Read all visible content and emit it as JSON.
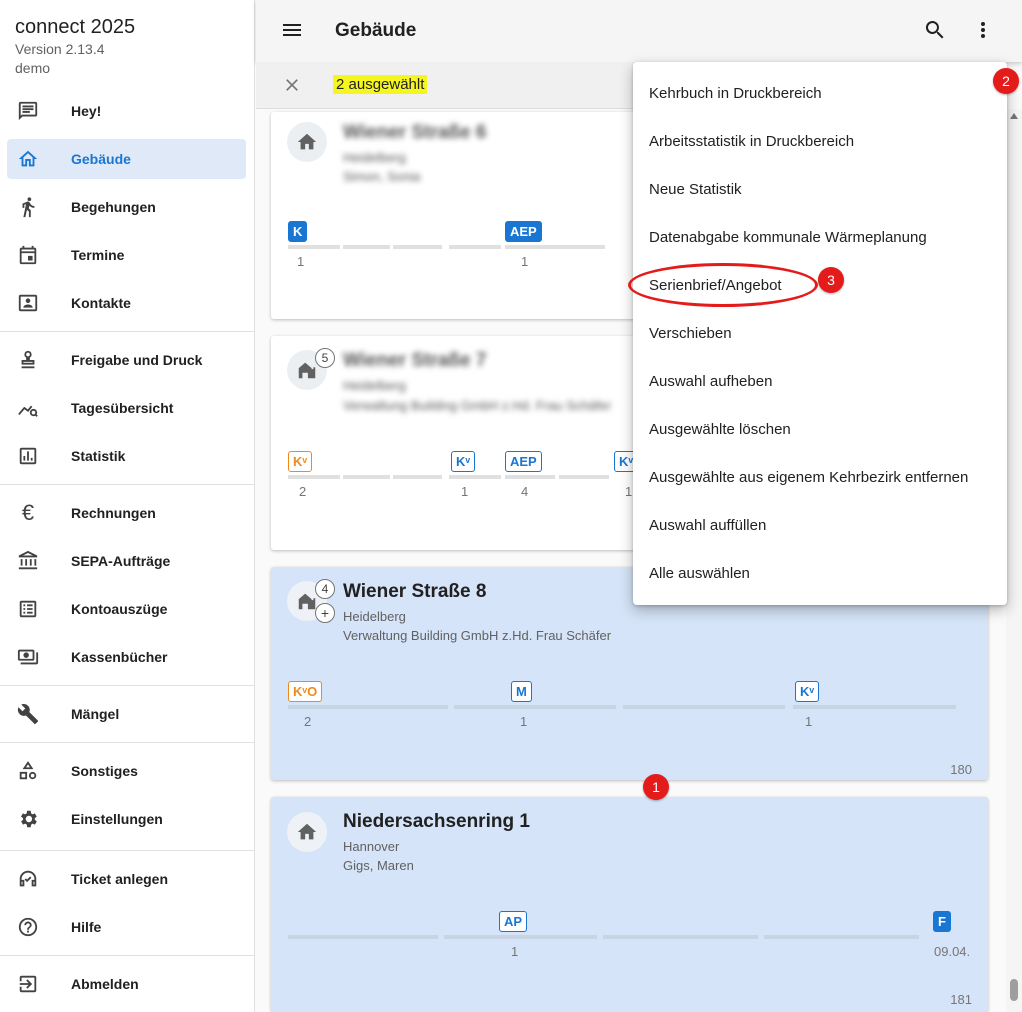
{
  "app": {
    "title": "connect 2025",
    "version": "Version 2.13.4",
    "user": "demo"
  },
  "sidebar": {
    "items": [
      {
        "label": "Hey!",
        "icon": "chat-icon"
      },
      {
        "label": "Gebäude",
        "icon": "home-icon",
        "active": true
      },
      {
        "label": "Begehungen",
        "icon": "walk-icon"
      },
      {
        "label": "Termine",
        "icon": "calendar-icon"
      },
      {
        "label": "Kontakte",
        "icon": "contact-card-icon"
      },
      {
        "label": "Freigabe und Druck",
        "icon": "stamp-icon"
      },
      {
        "label": "Tagesübersicht",
        "icon": "chart-search-icon"
      },
      {
        "label": "Statistik",
        "icon": "bar-chart-icon"
      },
      {
        "label": "Rechnungen",
        "icon": "euro-icon"
      },
      {
        "label": "SEPA-Aufträge",
        "icon": "bank-icon"
      },
      {
        "label": "Kontoauszüge",
        "icon": "list-icon"
      },
      {
        "label": "Kassenbücher",
        "icon": "cash-icon"
      },
      {
        "label": "Mängel",
        "icon": "wrench-icon"
      },
      {
        "label": "Sonstiges",
        "icon": "shapes-icon"
      },
      {
        "label": "Einstellungen",
        "icon": "gear-icon"
      },
      {
        "label": "Ticket anlegen",
        "icon": "support-agent-icon"
      },
      {
        "label": "Hilfe",
        "icon": "help-icon"
      },
      {
        "label": "Abmelden",
        "icon": "logout-icon"
      }
    ]
  },
  "header": {
    "title": "Gebäude"
  },
  "selection": {
    "count_label": "2 ausgewählt"
  },
  "cards": [
    {
      "title": "Wiener Straße 6",
      "line1": "Heidelberg",
      "line2": "Simon, Sonia",
      "tags": [
        "K",
        "AEP"
      ],
      "nums": [
        "1",
        "1"
      ]
    },
    {
      "count": "5",
      "title": "Wiener Straße 7",
      "line1": "Heidelberg",
      "line2": "Verwaltung Building GmbH z.Hd. Frau Schäfer",
      "tags": [
        "Kᵛ",
        "Kᵛ",
        "AEP",
        "Kᵛ"
      ],
      "nums": [
        "2",
        "1",
        "4",
        "1"
      ]
    },
    {
      "count": "4",
      "plus": "+",
      "title": "Wiener Straße 8",
      "line1": "Heidelberg",
      "line2": "Verwaltung Building GmbH z.Hd. Frau Schäfer",
      "tags": [
        "KᵛO",
        "M",
        "Kᵛ"
      ],
      "nums": [
        "2",
        "1",
        "1"
      ],
      "id": "180"
    },
    {
      "title": "Niedersachsenring 1",
      "line1": "Hannover",
      "line2": "Gigs, Maren",
      "tags": [
        "AP",
        "F"
      ],
      "nums": [
        "1",
        "09.04."
      ],
      "id": "181"
    }
  ],
  "menu": {
    "items": [
      "Kehrbuch in Druckbereich",
      "Arbeitsstatistik in Druckbereich",
      "Neue Statistik",
      "Datenabgabe kommunale Wärmeplanung",
      "Serienbrief/Angebot",
      "Verschieben",
      "Auswahl aufheben",
      "Ausgewählte löschen",
      "Ausgewählte aus eigenem Kehrbezirk entfernen",
      "Auswahl auffüllen",
      "Alle auswählen"
    ]
  },
  "markers": [
    "1",
    "2",
    "3"
  ],
  "colors": {
    "accent": "#1976d2",
    "selected_card": "#d5e4f8",
    "highlight": "#f5f520",
    "marker": "#e41b1b",
    "orange_tag": "#ef8a1a"
  }
}
